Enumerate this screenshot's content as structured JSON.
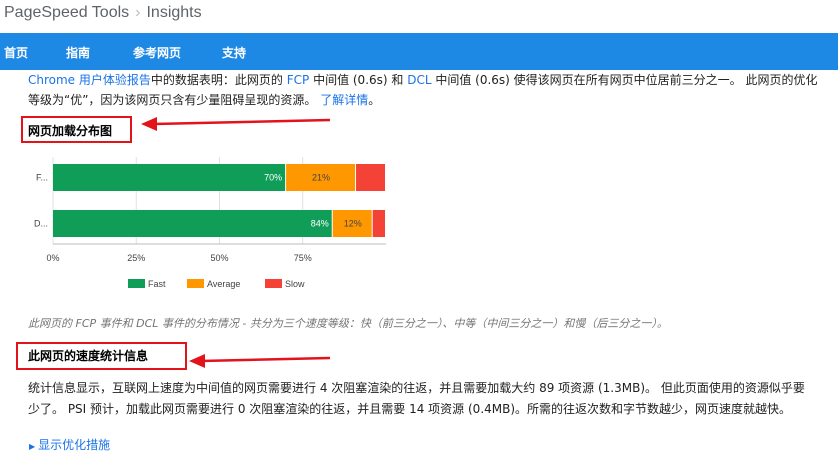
{
  "header": {
    "brand": "PageSpeed Tools",
    "separator": "›",
    "page": "Insights"
  },
  "nav": {
    "items": [
      "首页",
      "指南",
      "参考网页",
      "支持"
    ]
  },
  "intro": {
    "line1_link1": "Chrome 用户体验报告",
    "line1_text1": "中的数据表明：此网页的 ",
    "line1_link2": "FCP",
    "line1_text2": " 中间值 (0.6s) 和 ",
    "line1_link3": "DCL",
    "line1_text3": " 中间值 (0.6s) 使得该网页在所有网页中位居前三分之一。 此网页的优化",
    "line2_text": "等级为“优”，因为该网页只含有少量阻碍呈现的资源。 ",
    "line2_link": "了解详情",
    "line2_end": "。"
  },
  "section1": {
    "title": "网页加载分布图"
  },
  "section2": {
    "title": "此网页的速度统计信息"
  },
  "caption": "此网页的 FCP 事件和 DCL 事件的分布情况 - 共分为三个速度等级：快（前三分之一）、中等（中间三分之一）和慢（后三分之一）。",
  "stats": {
    "line1": "统计信息显示，互联网上速度为中间值的网页需要进行 4 次阻塞渲染的往返，并且需要加载大约 89 项资源 (1.3MB)。 但此页面使用的资源似乎要",
    "line2": "少了。 PSI 预计，加载此网页需要进行 0 次阻塞渲染的往返，并且需要 14 项资源 (0.4MB)。所需的往返次数和字节数越少，网页速度就越快。"
  },
  "more_link": "显示优化措施",
  "colors": {
    "fast": "#0f9d58",
    "average": "#ff9800",
    "slow": "#f44336",
    "nav": "#1e88e5",
    "annotation": "#e3131b"
  },
  "chart_data": {
    "type": "bar",
    "orientation": "horizontal-stacked",
    "categories": [
      "F...",
      "D..."
    ],
    "series": [
      {
        "name": "Fast",
        "values": [
          70,
          84
        ],
        "labels": [
          "70%",
          "84%"
        ]
      },
      {
        "name": "Average",
        "values": [
          21,
          12
        ],
        "labels": [
          "21%",
          "12%"
        ]
      },
      {
        "name": "Slow",
        "values": [
          9,
          4
        ],
        "labels": [
          "",
          ""
        ]
      }
    ],
    "xticks": [
      "0%",
      "25%",
      "50%",
      "75%"
    ],
    "xlim": [
      0,
      100
    ],
    "legend_position": "bottom",
    "grid": true
  }
}
